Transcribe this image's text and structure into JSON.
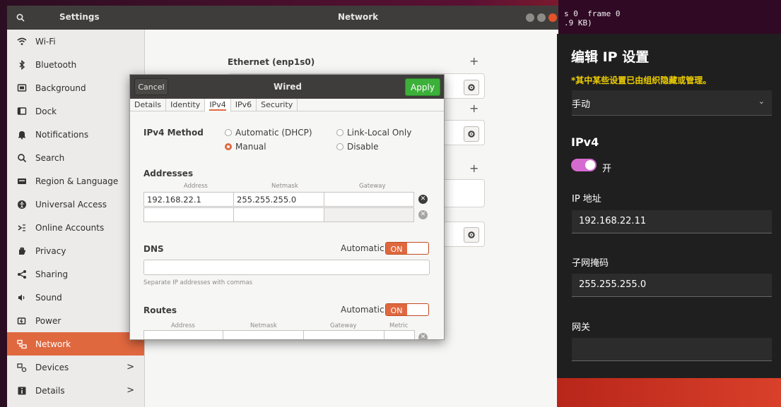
{
  "settings": {
    "sidebar_title": "Settings",
    "panel_title": "Network",
    "sidebar": [
      {
        "label": "Wi-Fi",
        "icon": "wifi-icon"
      },
      {
        "label": "Bluetooth",
        "icon": "bluetooth-icon"
      },
      {
        "label": "Background",
        "icon": "background-icon"
      },
      {
        "label": "Dock",
        "icon": "dock-icon"
      },
      {
        "label": "Notifications",
        "icon": "bell-icon"
      },
      {
        "label": "Search",
        "icon": "search-icon"
      },
      {
        "label": "Region & Language",
        "icon": "region-icon"
      },
      {
        "label": "Universal Access",
        "icon": "accessibility-icon"
      },
      {
        "label": "Online Accounts",
        "icon": "online-accounts-icon"
      },
      {
        "label": "Privacy",
        "icon": "privacy-hand-icon"
      },
      {
        "label": "Sharing",
        "icon": "share-icon"
      },
      {
        "label": "Sound",
        "icon": "speaker-icon"
      },
      {
        "label": "Power",
        "icon": "power-icon"
      },
      {
        "label": "Network",
        "icon": "network-icon",
        "active": true
      },
      {
        "label": "Devices",
        "icon": "devices-icon",
        "chevron": ">"
      },
      {
        "label": "Details",
        "icon": "details-icon",
        "chevron": ">"
      }
    ],
    "ethernet_heading": "Ethernet (enp1s0)"
  },
  "wired": {
    "cancel": "Cancel",
    "title": "Wired",
    "apply": "Apply",
    "tabs": [
      "Details",
      "Identity",
      "IPv4",
      "IPv6",
      "Security"
    ],
    "active_tab": "IPv4",
    "method_label": "IPv4 Method",
    "methods": {
      "dhcp": "Automatic (DHCP)",
      "link_local": "Link-Local Only",
      "manual": "Manual",
      "disable": "Disable"
    },
    "selected_method": "Manual",
    "addresses_label": "Addresses",
    "col_address": "Address",
    "col_netmask": "Netmask",
    "col_gateway": "Gateway",
    "col_metric": "Metric",
    "address_rows": [
      {
        "address": "192.168.22.1",
        "netmask": "255.255.255.0",
        "gateway": ""
      },
      {
        "address": "",
        "netmask": "",
        "gateway": ""
      }
    ],
    "dns_label": "DNS",
    "automatic": "Automatic",
    "on": "ON",
    "dns_value": "",
    "dns_help": "Separate IP addresses with commas",
    "routes_label": "Routes"
  },
  "terminal": {
    "line1": "s 0  frame 0",
    "line2": ".9 KB)"
  },
  "ip_panel": {
    "title": "编辑 IP 设置",
    "notice": "*其中某些设置已由组织隐藏或管理。",
    "mode": "手动",
    "ipv4": "IPv4",
    "toggle_label": "开",
    "ip_label": "IP 地址",
    "ip_value": "192.168.22.11",
    "mask_label": "子网掩码",
    "mask_value": "255.255.255.0",
    "gateway_label": "网关",
    "gateway_value": ""
  }
}
